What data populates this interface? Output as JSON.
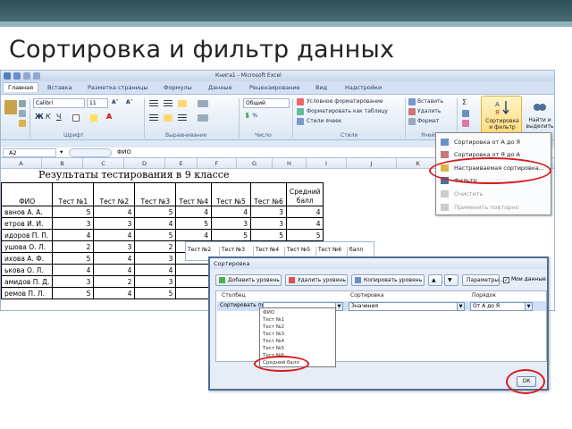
{
  "slide": {
    "title": "Сортировка и фильтр данных"
  },
  "excel": {
    "window_title": "Книга1 - Microsoft Excel",
    "tabs": [
      "Главная",
      "Вставка",
      "Разметка страницы",
      "Формулы",
      "Данные",
      "Рецензирование",
      "Вид",
      "Надстройки"
    ],
    "font_name": "Calibri",
    "font_size": "11",
    "number_format": "Общий",
    "groups": {
      "font": "Шрифт",
      "alignment": "Выравнивание",
      "number": "Число",
      "styles": "Стили",
      "cells": "Ячейки"
    },
    "styles_buttons": [
      "Условное форматирование",
      "Форматировать как таблицу",
      "Стили ячеек"
    ],
    "cells_buttons": [
      "Вставить",
      "Удалить",
      "Формат"
    ],
    "sort_filter_label": "Сортировка и фильтр",
    "find_select_label": "Найти и выделить",
    "name_box": "A2",
    "formula_value": "ФИО",
    "columns": [
      "A",
      "B",
      "C",
      "D",
      "E",
      "F",
      "G",
      "H",
      "I",
      "J",
      "K"
    ]
  },
  "report": {
    "title": "Результаты тестирования в 9 классе",
    "headers": [
      "ФИО",
      "Тест №1",
      "Тест №2",
      "Тест №3",
      "Тест №4",
      "Тест №5",
      "Тест №6",
      "Средний балл"
    ],
    "rows": [
      [
        "ванов А. А.",
        "5",
        "4",
        "5",
        "4",
        "4",
        "3",
        "4"
      ],
      [
        "етров И. И.",
        "3",
        "3",
        "4",
        "5",
        "3",
        "3",
        "4"
      ],
      [
        "идоров П. П.",
        "4",
        "4",
        "5",
        "4",
        "5",
        "5",
        "5"
      ],
      [
        "ушова О. Л.",
        "2",
        "3",
        "2",
        "3",
        "4",
        "",
        ""
      ],
      [
        "ихова А. Ф.",
        "5",
        "4",
        "3",
        "",
        "",
        "",
        ""
      ],
      [
        "ькова О. Л.",
        "4",
        "4",
        "4",
        "",
        "",
        "",
        ""
      ],
      [
        "амидов П. Д.",
        "3",
        "2",
        "3",
        "",
        "",
        "",
        ""
      ],
      [
        "ремов П. Л.",
        "5",
        "4",
        "5",
        "",
        "",
        "",
        ""
      ]
    ]
  },
  "sort_menu": {
    "items": [
      {
        "label": "Сортировка от А до Я",
        "disabled": false
      },
      {
        "label": "Сортировка от Я до А",
        "disabled": false
      },
      {
        "label": "Настраиваемая сортировка...",
        "disabled": false
      },
      {
        "label": "Фильтр",
        "disabled": false
      },
      {
        "label": "Очистить",
        "disabled": true
      },
      {
        "label": "Применить повторно",
        "disabled": true
      }
    ]
  },
  "strip": {
    "cells": [
      "Тест №2",
      "Тест №3",
      "Тест №4",
      "Тест №5",
      "Тест №6",
      "балл"
    ]
  },
  "sort_dialog": {
    "title": "Сортировка",
    "buttons": [
      "Добавить уровень",
      "Удалить уровень",
      "Копировать уровень",
      "Параметры..."
    ],
    "checkbox_label": "Мои данные содержат заголовки",
    "col_header": "Столбец",
    "sort_on_header": "Сортировка",
    "order_header": "Порядок",
    "sort_by_label": "Сортировать по",
    "sort_on_value": "Значения",
    "order_value": "От А до Я",
    "dropdown_items": [
      "ФИО",
      "Тест №1",
      "Тест №2",
      "Тест №3",
      "Тест №4",
      "Тест №5",
      "Тест №6",
      "Средний балл"
    ],
    "ok": "ОК"
  },
  "colors": {
    "highlight": "#d91c1c",
    "ribbon": "#dfe8f5",
    "accent": "#1e3f73"
  }
}
